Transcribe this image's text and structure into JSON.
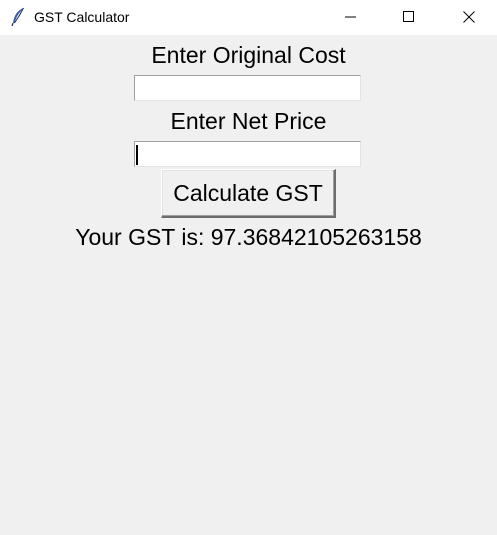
{
  "window": {
    "title": "GST Calculator",
    "icon": "feather-icon",
    "controls": [
      "minimize-icon",
      "maximize-icon",
      "close-icon"
    ]
  },
  "form": {
    "original_cost_label": "Enter Original Cost",
    "original_cost_value": "",
    "net_price_label": "Enter Net Price",
    "net_price_value": "",
    "calculate_button_label": "Calculate GST",
    "result_text": "Your GST is: 97.36842105263158"
  },
  "colors": {
    "background": "#f0f0f0",
    "titlebar": "#ffffff",
    "entry_background": "#ffffff",
    "text": "#000000"
  }
}
